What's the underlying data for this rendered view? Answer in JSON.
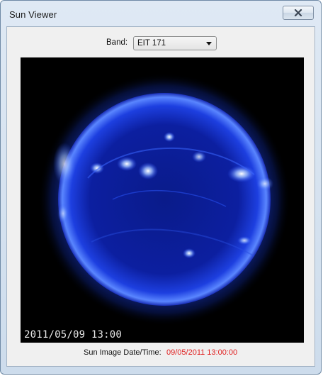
{
  "window": {
    "title": "Sun Viewer"
  },
  "band": {
    "label": "Band:",
    "selected": "EIT 171"
  },
  "image": {
    "stamp": "2011/05/09 13:00"
  },
  "status": {
    "label": "Sun Image Date/Time:",
    "value": "09/05/2011 13:00:00",
    "value_color": "#e02020"
  },
  "icons": {
    "close": "close-icon",
    "dropdown": "chevron-down-icon"
  }
}
